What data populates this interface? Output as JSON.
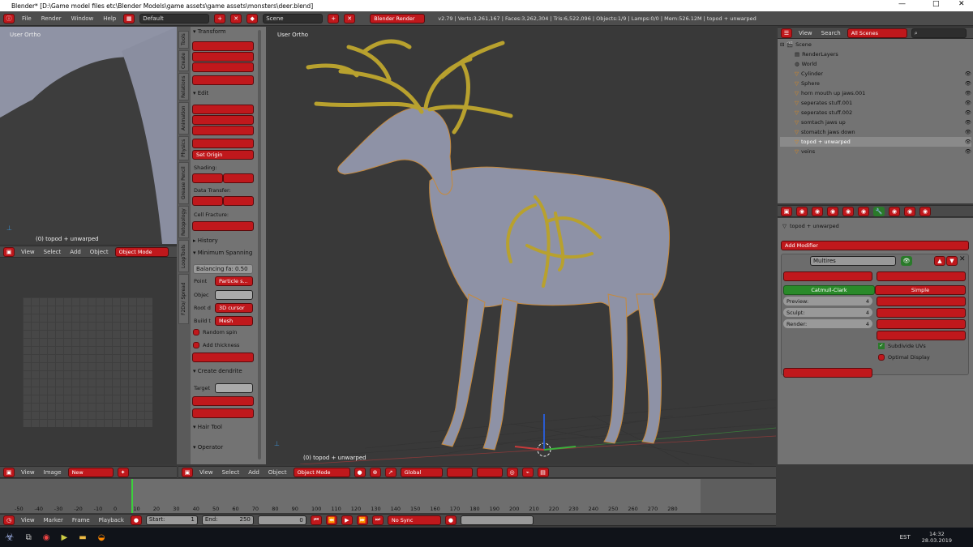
{
  "window": {
    "title": "Blender* [D:\\Game model files etc\\Blender Models\\game assets\\game assets\\monsters\\deer.blend]",
    "min_glyph": "—",
    "max_glyph": "□",
    "close_glyph": "✕"
  },
  "topbar": {
    "menus": [
      "File",
      "Render",
      "Window",
      "Help"
    ],
    "layout": "Default",
    "scene": "Scene",
    "engine": "Blender Render",
    "stats": "v2.79 | Verts:3,261,167 | Faces:3,262,304 | Tris:6,522,096 | Objects:1/9 | Lamps:0/0 | Mem:526.12M | topod + unwarped"
  },
  "uv_view": {
    "label": "User Ortho",
    "object": "(0) topod + unwarped"
  },
  "uv_header": {
    "items": [
      "View",
      "Select",
      "Add",
      "Object"
    ],
    "mode": "Object Mode"
  },
  "tool_tabs": [
    "Tools",
    "Create",
    "Relations",
    "Animation",
    "Physics",
    "Grease Pencil",
    "Retopology",
    "LoopTools",
    "F2Do/ Spread"
  ],
  "tool_shelf": {
    "transform": "Transform",
    "edit": "Edit",
    "set_origin": "Set Origin",
    "shading": "Shading:",
    "data_transfer": "Data Transfer:",
    "cell_fracture": "Cell Fracture:",
    "history": "History",
    "min_span": "Minimum Spanning",
    "balancing": "Balancing fa: 0.50",
    "point_lbl": "Point",
    "point_val": "Particle s...",
    "objec_lbl": "Objec",
    "root_lbl": "Root d",
    "root_val": "3D cursor",
    "build_lbl": "Build t",
    "build_val": "Mesh",
    "random_spin": "Random spin",
    "add_thickness": "Add thickness",
    "create_dendrite": "Create dendrite",
    "target_lbl": "Target",
    "hair_tool": "Hair Tool",
    "operator": "Operator"
  },
  "viewport": {
    "label": "User Ortho",
    "object": "(0) topod + unwarped"
  },
  "outliner": {
    "header": [
      "View",
      "Search"
    ],
    "scenes": "All Scenes",
    "items": [
      "Scene",
      "RenderLayers",
      "World",
      "Cylinder",
      "Sphere",
      "horn mouth up jaws.001",
      "seperates stuff.001",
      "seperates stuff.002",
      "somtach jaws up",
      "stomatch jaws down",
      "topod + unwarped",
      "veins"
    ]
  },
  "properties": {
    "object": "topod + unwarped",
    "add_modifier": "Add Modifier",
    "modifier_name": "Multires",
    "catmull": "Catmull-Clark",
    "simple": "Simple",
    "preview_lbl": "Preview:",
    "preview_val": "4",
    "sculpt_lbl": "Sculpt:",
    "sculpt_val": "4",
    "render_lbl": "Render:",
    "render_val": "4",
    "subdivide_uvs": "Subdivide UVs",
    "optimal_display": "Optimal Display"
  },
  "image_header": {
    "items": [
      "View",
      "Image"
    ],
    "new": "New"
  },
  "view3d_header": {
    "items": [
      "View",
      "Select",
      "Add",
      "Object"
    ],
    "mode": "Object Mode",
    "orientation": "Global"
  },
  "timeline": {
    "ticks": [
      "-50",
      "-40",
      "-30",
      "-20",
      "-10",
      "0",
      "10",
      "20",
      "30",
      "40",
      "50",
      "60",
      "70",
      "80",
      "90",
      "100",
      "110",
      "120",
      "130",
      "140",
      "150",
      "160",
      "170",
      "180",
      "190",
      "200",
      "210",
      "220",
      "230",
      "240",
      "250",
      "260",
      "270",
      "280"
    ],
    "header": [
      "View",
      "Marker",
      "Frame",
      "Playback"
    ],
    "start": "Start:",
    "start_val": "1",
    "end": "End:",
    "end_val": "250",
    "current": "0",
    "sync": "No Sync"
  },
  "taskbar": {
    "lang": "EST",
    "time": "14:32",
    "date": "28.03.2019"
  },
  "colors": {
    "accent": "#c0181c",
    "horn": "#b8a12e",
    "body": "#8e92a6"
  }
}
